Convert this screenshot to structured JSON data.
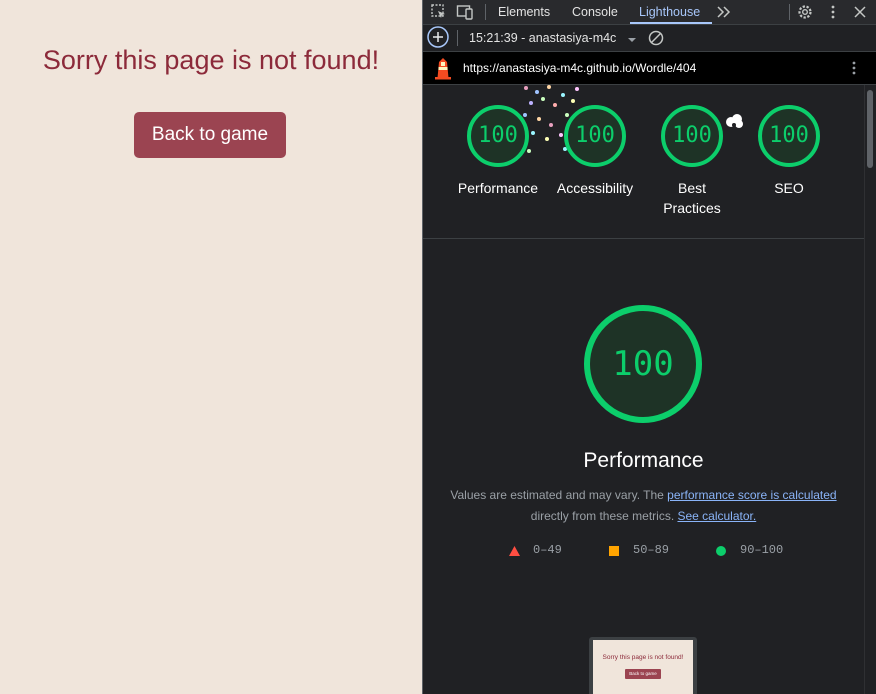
{
  "page": {
    "heading": "Sorry this page is not found!",
    "back_button": "Back to game"
  },
  "devtools": {
    "tabs": [
      {
        "label": "Elements"
      },
      {
        "label": "Console"
      },
      {
        "label": "Lighthouse",
        "active": true
      }
    ],
    "more_tabs_icon": "double-chevron-right",
    "report_selector": "15:21:39 - anastasiya-m4c",
    "url": "https://anastasiya-m4c.github.io/Wordle/404",
    "accent_color": "#a8c7fa"
  },
  "scores": [
    {
      "value": "100",
      "label": "Performance"
    },
    {
      "value": "100",
      "label": "Accessibility"
    },
    {
      "value": "100",
      "label": "Best Practices"
    },
    {
      "value": "100",
      "label": "SEO"
    }
  ],
  "performance": {
    "score": "100",
    "title": "Performance",
    "desc_prefix": "Values are estimated and may vary. The ",
    "desc_link": "performance score is calculated",
    "desc_middle": "directly from these metrics. ",
    "desc_link2": "See calculator.",
    "pass_color": "#0cce6b"
  },
  "legend": [
    {
      "range": "0–49",
      "shape": "triangle",
      "color": "#ff4e42"
    },
    {
      "range": "50–89",
      "shape": "square",
      "color": "#ffa400"
    },
    {
      "range": "90–100",
      "shape": "circle",
      "color": "#0cce6b"
    }
  ],
  "thumbnail": {
    "title": "Sorry this page is not found!",
    "button": "Back to game"
  }
}
